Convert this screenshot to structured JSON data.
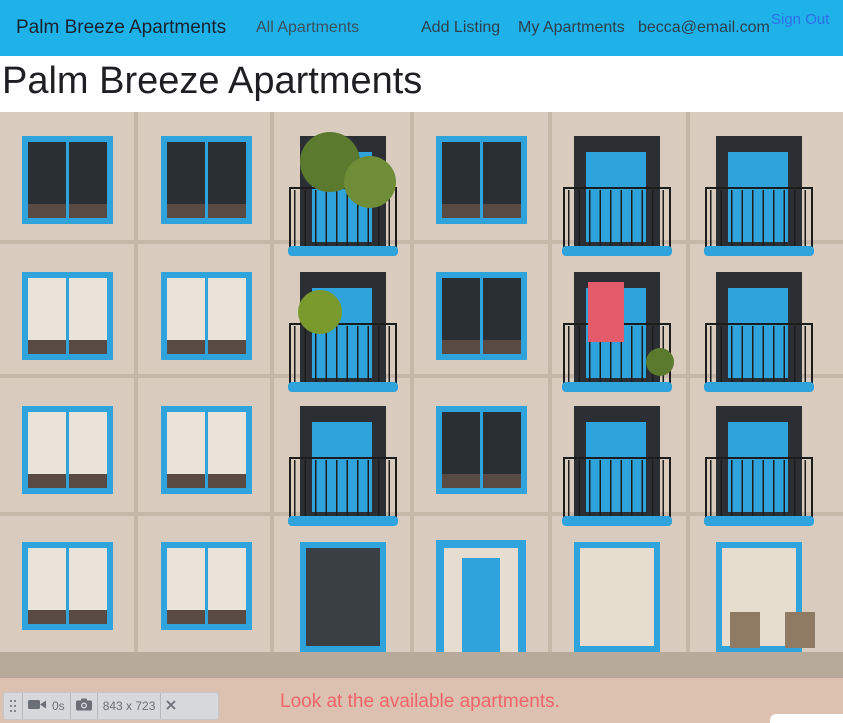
{
  "navbar": {
    "brand": "Palm Breeze Apartments",
    "links": {
      "all_apartments": "All Apartments",
      "add_listing": "Add Listing",
      "my_apartments": "My Apartments"
    },
    "user_email": "becca@email.com",
    "sign_out": "Sign Out"
  },
  "page": {
    "title": "Palm Breeze Apartments"
  },
  "hero": {
    "description": "apartment building facade with blue framed windows and balconies"
  },
  "banner": {
    "message": "Look at the available apartments."
  },
  "recorder": {
    "duration": "0s",
    "dimensions": "843 x 723",
    "icons": [
      "drag-handle-icon",
      "video-camera-icon",
      "camera-icon",
      "close-icon"
    ]
  },
  "colors": {
    "navbar_bg": "#1eb2e8",
    "sign_out": "#2f6fe8",
    "banner_bg": "#dcc1b0",
    "banner_text": "#f0646a",
    "window_frame": "#2ea3dc"
  }
}
